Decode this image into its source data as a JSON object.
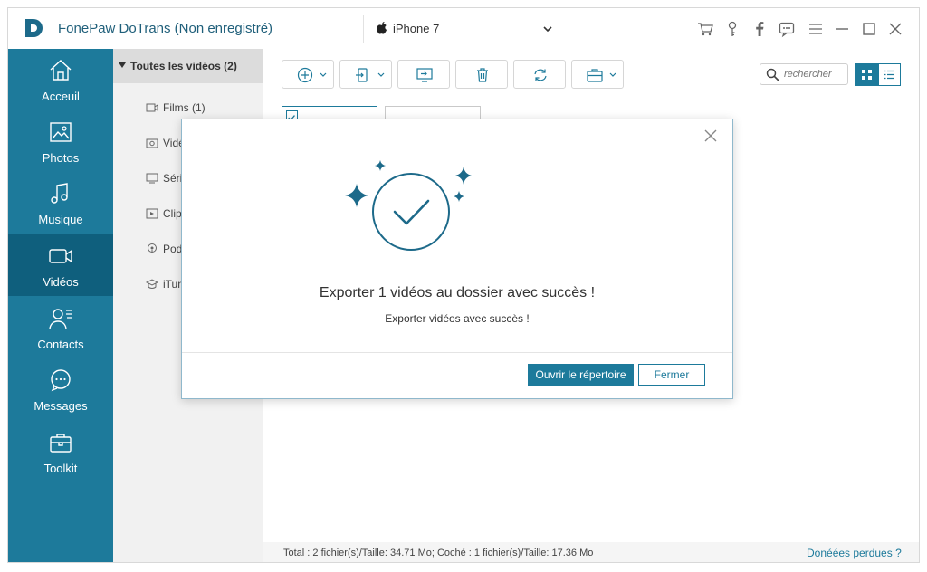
{
  "window": {
    "title": "FonePaw DoTrans (Non enregistré)",
    "device": "iPhone 7"
  },
  "titlebar_icons": [
    "cart-icon",
    "key-icon",
    "facebook-icon",
    "feedback-icon",
    "menu-icon",
    "minimize-icon",
    "maximize-icon",
    "close-icon"
  ],
  "sidebar": {
    "items": [
      {
        "label": "Acceuil",
        "icon": "home-icon"
      },
      {
        "label": "Photos",
        "icon": "photo-icon"
      },
      {
        "label": "Musique",
        "icon": "music-icon"
      },
      {
        "label": "Vidéos",
        "icon": "video-icon",
        "active": true
      },
      {
        "label": "Contacts",
        "icon": "contacts-icon"
      },
      {
        "label": "Messages",
        "icon": "messages-icon"
      },
      {
        "label": "Toolkit",
        "icon": "toolkit-icon"
      }
    ]
  },
  "categories": {
    "header": "Toutes les vidéos (2)",
    "items": [
      {
        "label": "Films (1)",
        "icon": "film-icon"
      },
      {
        "label": "Vidé",
        "icon": "camera-icon"
      },
      {
        "label": "Séri",
        "icon": "tv-icon"
      },
      {
        "label": "Clip",
        "icon": "clip-icon"
      },
      {
        "label": "Pod",
        "icon": "podcast-icon"
      },
      {
        "label": "iTun",
        "icon": "itunes-u-icon"
      }
    ]
  },
  "toolbar": {
    "buttons": [
      "add-icon",
      "export-device-icon",
      "export-pc-icon",
      "delete-icon",
      "refresh-icon",
      "toolbox-icon"
    ],
    "search_placeholder": "rechercher"
  },
  "status": {
    "info": "Total : 2 fichier(s)/Taille: 34.71 Mo; Coché : 1 fichier(s)/Taille: 17.36 Mo",
    "lost_link": "Donéées perdues ?"
  },
  "dialog": {
    "title": "Exporter 1 vidéos au dossier avec succès !",
    "subtitle": "Exporter vidéos avec succès !",
    "open_button": "Ouvrir le répertoire",
    "close_button": "Fermer"
  },
  "colors": {
    "accent": "#1d7a9b",
    "accent_dark": "#0f5f7d",
    "sidebar": "#1d7a9b"
  }
}
